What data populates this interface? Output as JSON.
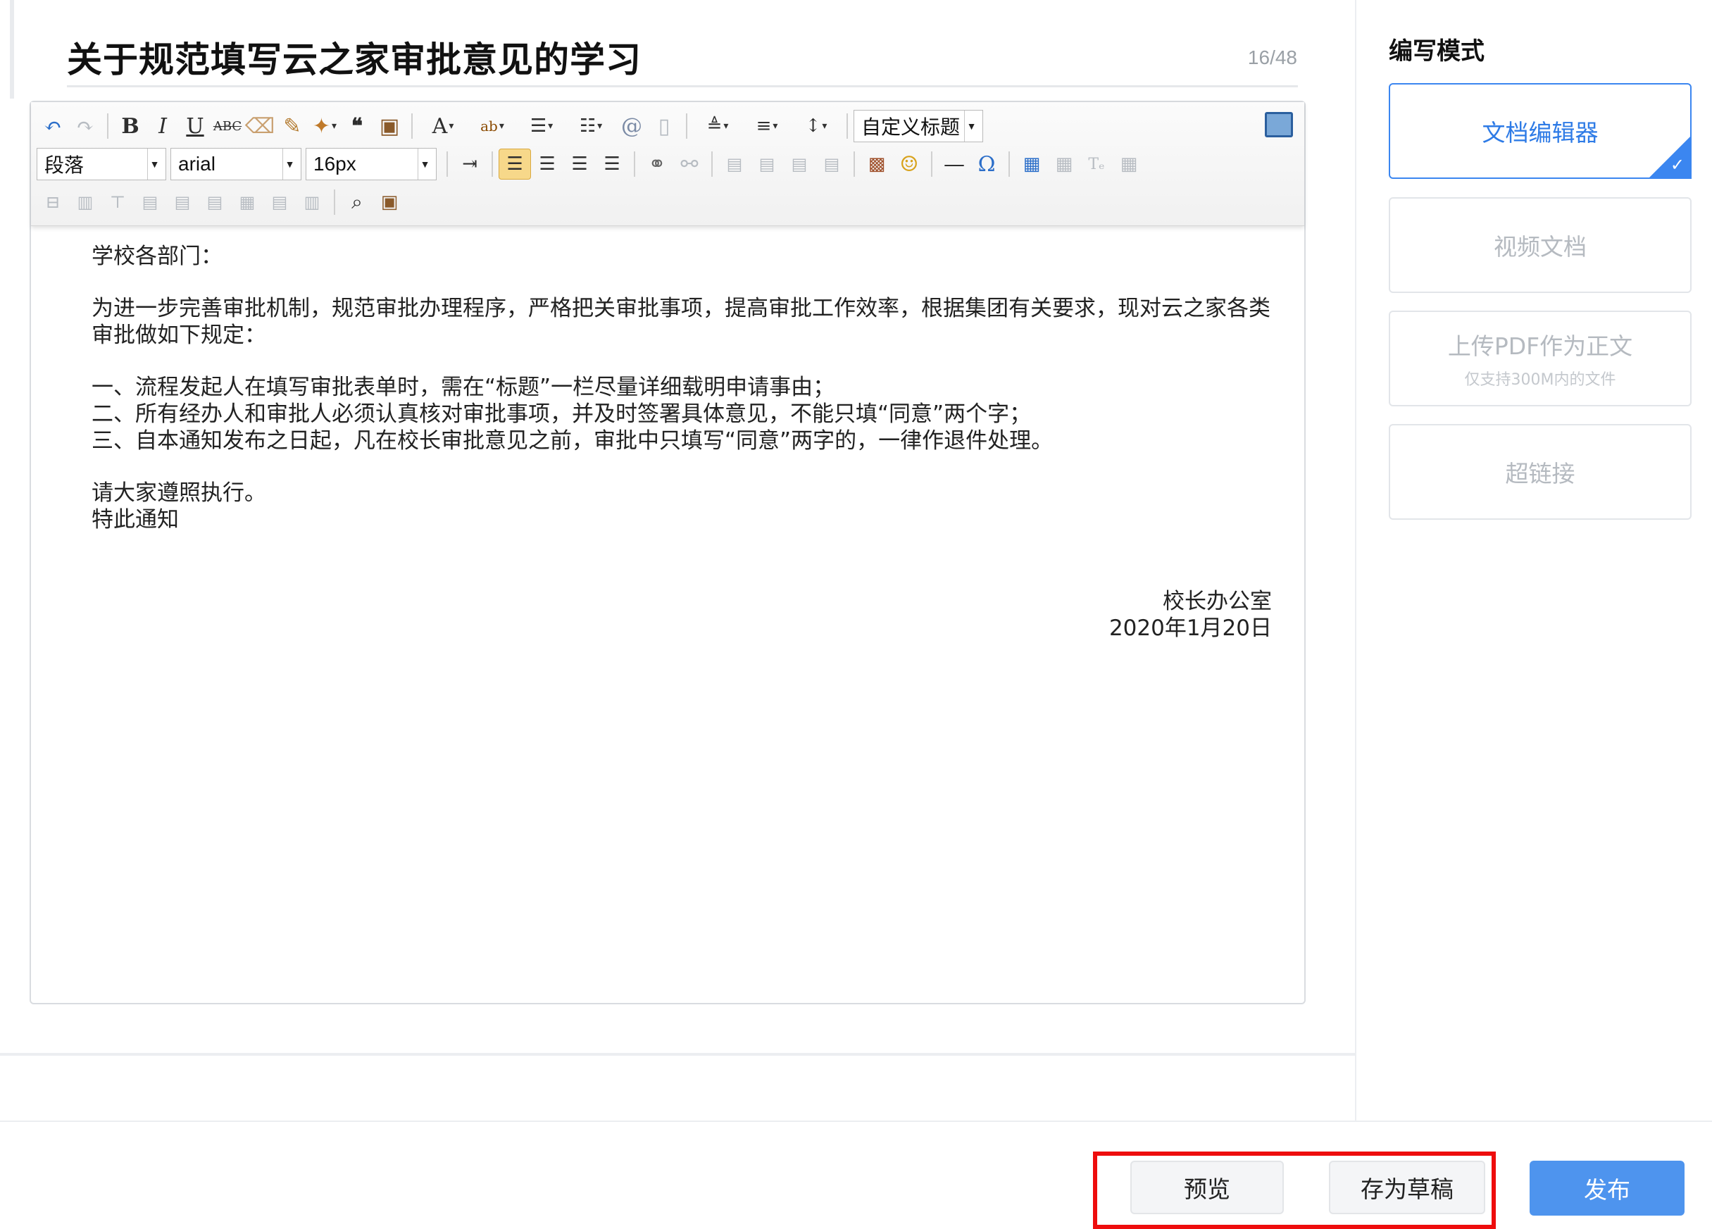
{
  "header": {
    "title": "关于规范填写云之家审批意见的学习",
    "char_count": "16/48"
  },
  "toolbar": {
    "paragraph_select": "段落",
    "font_select": "arial",
    "size_select": "16px",
    "heading_select": "自定义标题"
  },
  "document": {
    "salutation": "学校各部门：",
    "intro": "为进一步完善审批机制，规范审批办理程序，严格把关审批事项，提高审批工作效率，根据集团有关要求，现对云之家各类审批做如下规定：",
    "items": [
      "一、流程发起人在填写审批表单时，需在“标题”一栏尽量详细载明申请事由；",
      "二、所有经办人和审批人必须认真核对审批事项，并及时签署具体意见，不能只填“同意”两个字；",
      "三、自本通知发布之日起，凡在校长审批意见之前，审批中只填写“同意”两字的，一律作退件处理。"
    ],
    "closing": [
      "请大家遵照执行。",
      "特此通知"
    ],
    "signature": "校长办公室",
    "date": "2020年1月20日"
  },
  "mode_panel": {
    "title": "编写模式",
    "modes": [
      {
        "label": "文档编辑器",
        "sub": "",
        "active": true
      },
      {
        "label": "视频文档",
        "sub": "",
        "active": false
      },
      {
        "label": "上传PDF作为正文",
        "sub": "仅支持300M内的文件",
        "active": false
      },
      {
        "label": "超链接",
        "sub": "",
        "active": false
      }
    ]
  },
  "footer": {
    "preview": "预览",
    "draft": "存为草稿",
    "publish": "发布"
  },
  "colors": {
    "accent": "#3b86f0",
    "publish_button": "#4e94ee",
    "highlight_box": "#ee0d0d"
  }
}
